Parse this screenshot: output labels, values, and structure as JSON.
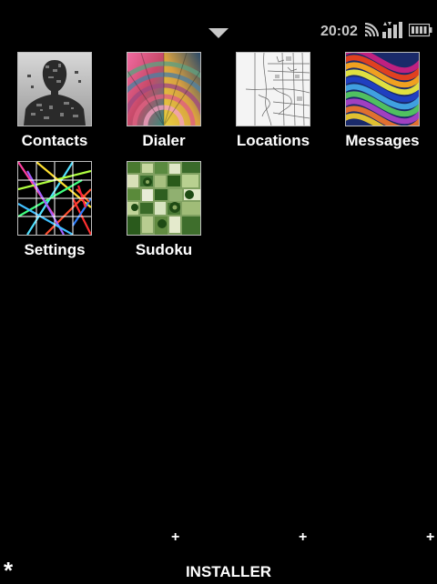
{
  "status_bar": {
    "time": "20:02",
    "icons": [
      "drawer-arrow-icon",
      "wifi-icon",
      "signal-icon",
      "battery-icon"
    ],
    "text_color": "#c8c8c8"
  },
  "apps": [
    {
      "label": "Contacts",
      "icon": "contacts-icon"
    },
    {
      "label": "Dialer",
      "icon": "dialer-icon"
    },
    {
      "label": "Locations",
      "icon": "locations-icon"
    },
    {
      "label": "Messages",
      "icon": "messages-icon"
    },
    {
      "label": "Settings",
      "icon": "settings-icon"
    },
    {
      "label": "Sudoku",
      "icon": "sudoku-icon"
    }
  ],
  "dock": {
    "plus_markers": [
      "+",
      "+",
      "+"
    ],
    "star": "*",
    "installer_label": "INSTALLER"
  }
}
